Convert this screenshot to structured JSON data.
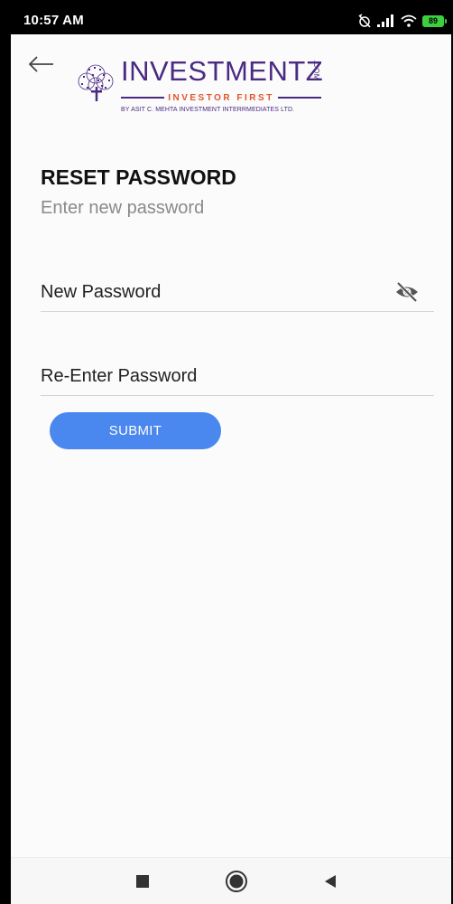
{
  "status_bar": {
    "time": "10:57 AM",
    "battery": "89"
  },
  "header": {
    "logo": {
      "word": "INVESTMENTZ",
      "com": ".COM",
      "tagline": "INVESTOR FIRST",
      "subtitle": "BY ASIT C. MEHTA INVESTMENT INTERRMEDIATES LTD."
    }
  },
  "main": {
    "title": "RESET PASSWORD",
    "subtitle": "Enter new password",
    "new_password": {
      "placeholder": "New Password",
      "value": ""
    },
    "reenter_password": {
      "placeholder": "Re-Enter Password",
      "value": ""
    },
    "submit_label": "SUBMIT"
  },
  "icons": {
    "back": "arrow-left-icon",
    "eye": "eye-off-icon",
    "recents": "square-icon",
    "home": "circle-icon",
    "nav_back": "triangle-left-icon"
  },
  "colors": {
    "brand_purple": "#4b2a82",
    "brand_orange": "#e2552b",
    "accent_blue": "#4a87ee"
  }
}
